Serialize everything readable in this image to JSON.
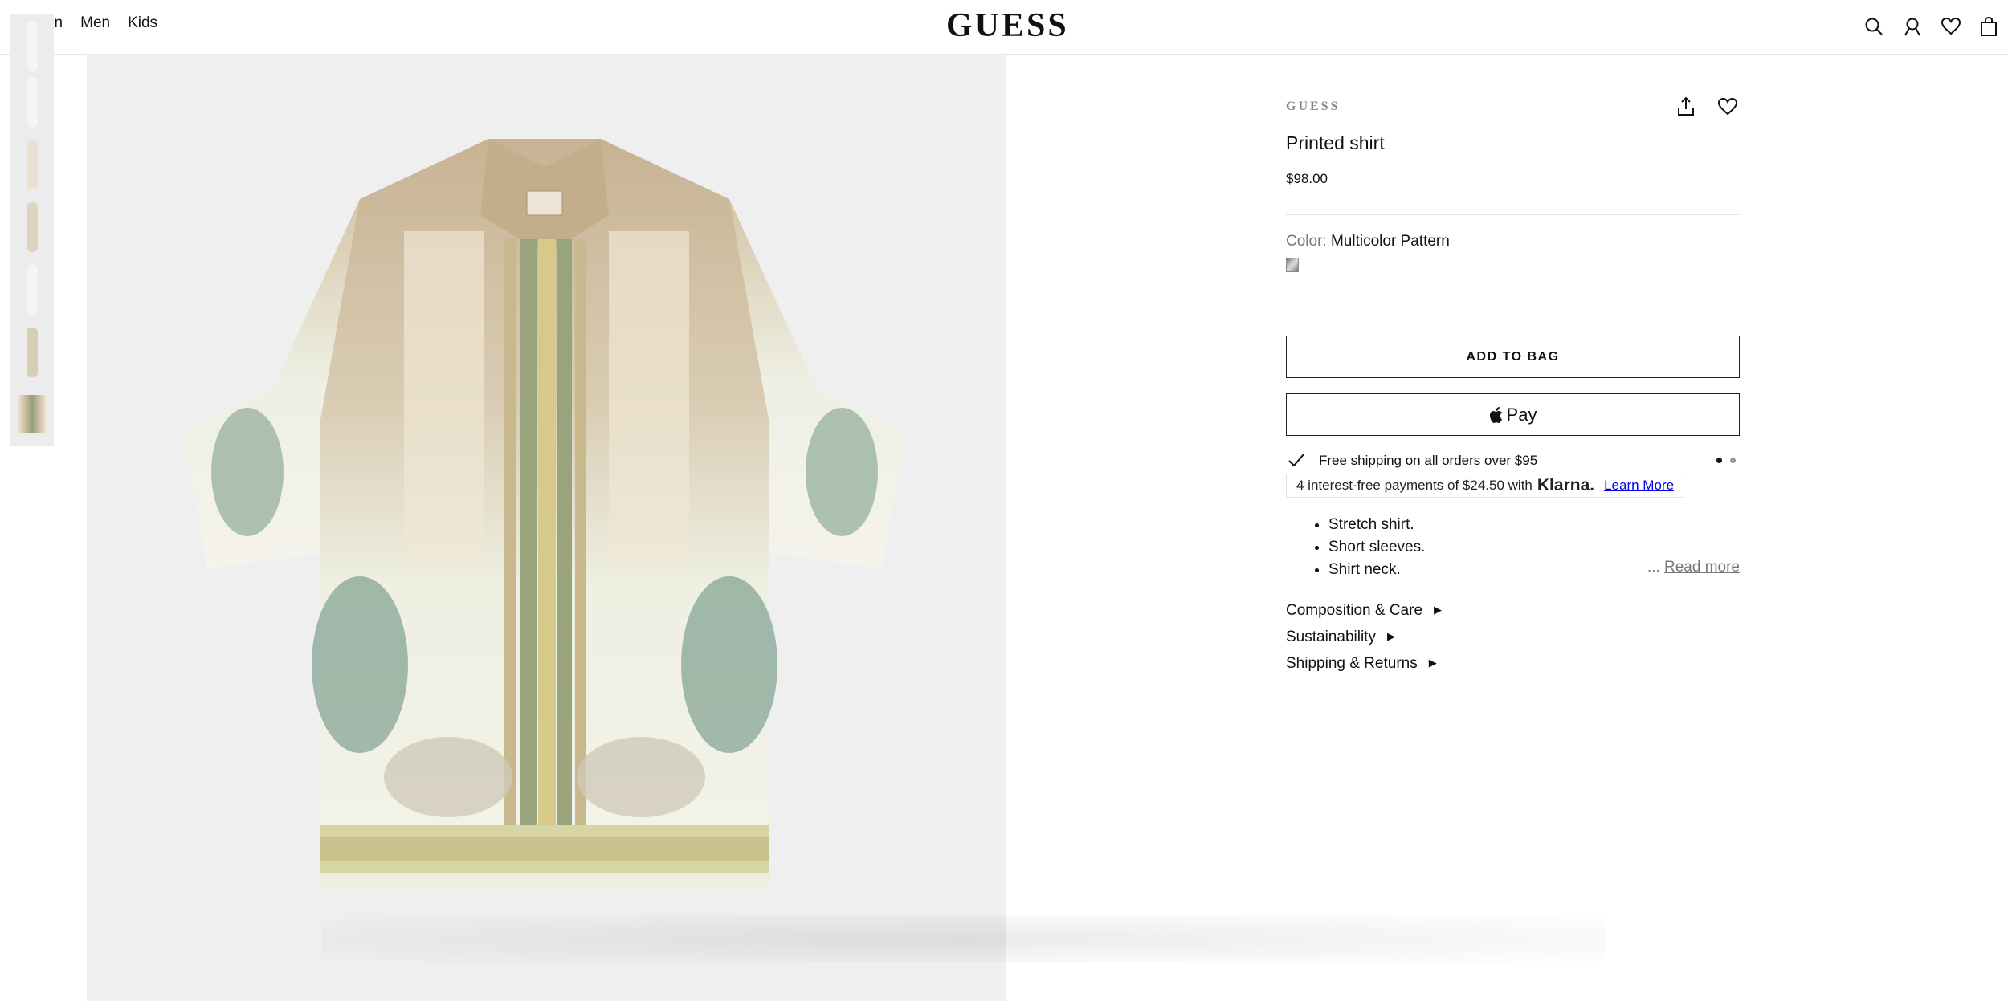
{
  "nav": {
    "items": [
      "Women",
      "Men",
      "Kids"
    ]
  },
  "header": {
    "logo": "GUESS"
  },
  "icons": {
    "search": "search-icon",
    "account": "account-icon",
    "wishlist": "heart-icon",
    "bag": "bag-icon"
  },
  "product": {
    "brand": "GUESS",
    "title": "Printed shirt",
    "price": "$98.00",
    "color_label": "Color:",
    "color_value": "Multicolor Pattern",
    "add_to_bag": "ADD TO BAG",
    "apple_pay": "Pay",
    "shipping_text": "Free shipping on all orders over $95",
    "klarna_prefix": "4 interest-free payments of $24.50 with",
    "klarna_brand": "Klarna.",
    "klarna_link": "Learn More",
    "features": [
      "Stretch shirt.",
      "Short sleeves.",
      "Shirt neck."
    ],
    "read_more_prefix": "...",
    "read_more": "Read more",
    "accordions": [
      "Composition & Care",
      "Sustainability",
      "Shipping & Returns"
    ]
  },
  "colors": {
    "text": "#111111",
    "muted": "#777777",
    "image_bg": "#efefef"
  }
}
